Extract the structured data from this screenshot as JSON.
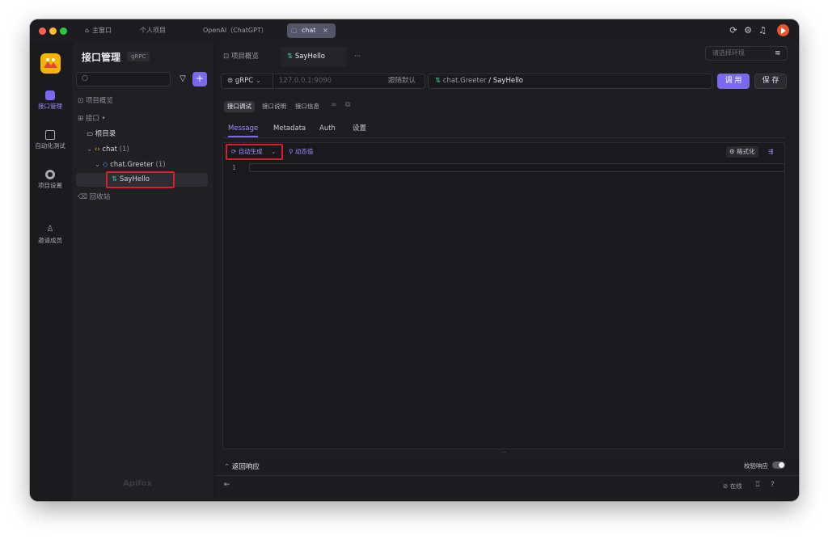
{
  "titlebar": {
    "tabs": [
      "主窗口",
      "个人项目",
      "OpenAI（ChatGPT）",
      "chat"
    ],
    "close_glyph": "×"
  },
  "rail": {
    "items": [
      "接口管理",
      "自动化测试",
      "项目设置",
      "邀请成员"
    ]
  },
  "sidebar": {
    "title": "接口管理",
    "badge": "gRPC",
    "add_glyph": "+",
    "overview": "项目概览",
    "interfaces": "接口",
    "interfaces_suffix": "•",
    "root": "根目录",
    "chat": "chat",
    "chat_count": "(1)",
    "greeter": "chat.Greeter",
    "greeter_count": "(1)",
    "method": "SayHello",
    "trash": "回收站",
    "watermark": "Apifox"
  },
  "main": {
    "tabs": [
      "项目概览",
      "SayHello"
    ],
    "more": "···",
    "env_placeholder": "请选择环境",
    "protocol": "gRPC",
    "address": "127.0.0.1:9090",
    "follow_default": "跟随默认",
    "path_service": "chat.Greeter",
    "path_sep": " / ",
    "path_method": "SayHello",
    "call": "调 用",
    "save": "保 存",
    "subtabs": [
      "接口调试",
      "接口说明",
      "接口信息"
    ],
    "bodytabs": [
      "Message",
      "Metadata",
      "Auth",
      "设置"
    ],
    "auto_generate": "自动生成",
    "dynamic_value": "动态值",
    "format": "格式化",
    "line_number": "1",
    "response": "返回响应",
    "validate": "校验响应",
    "online": "在线",
    "divider": "···"
  },
  "colors": {
    "accent": "#7a68ee",
    "highlight_box": "#d3202a",
    "grpc_green": "#3ec28f"
  }
}
